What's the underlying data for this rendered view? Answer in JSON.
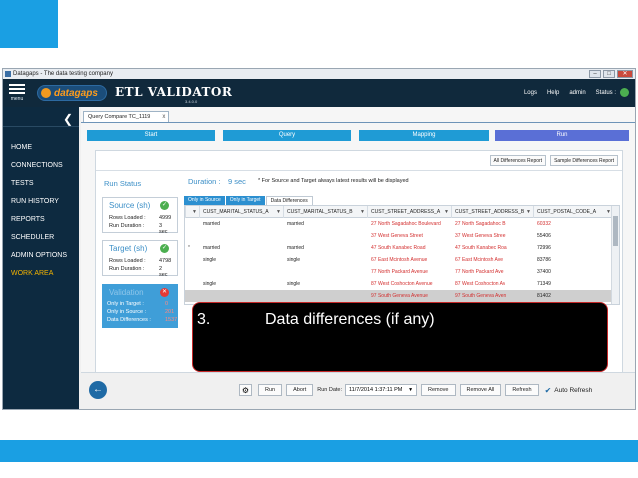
{
  "window": {
    "title": "Datagaps - The data testing company",
    "controls": [
      "–",
      "□",
      "✕"
    ]
  },
  "header": {
    "menu_label": "menu",
    "logo_text": "datagaps",
    "product_title": "ETL VALIDATOR",
    "version": "3.4.0.0",
    "links": {
      "logs": "Logs",
      "help": "Help",
      "user": "admin",
      "status_label": "Status :"
    },
    "status_color": "#4caf50"
  },
  "sidebar": {
    "back_icon": "chevron-left-icon",
    "items": [
      {
        "label": "HOME"
      },
      {
        "label": "CONNECTIONS"
      },
      {
        "label": "TESTS"
      },
      {
        "label": "RUN HISTORY"
      },
      {
        "label": "REPORTS"
      },
      {
        "label": "SCHEDULER"
      },
      {
        "label": "ADMIN OPTIONS"
      },
      {
        "label": "WORK AREA",
        "active": true
      }
    ]
  },
  "doc_tab": {
    "label": "Query Compare TC_1119",
    "close": "x"
  },
  "steps": [
    {
      "label": "Start"
    },
    {
      "label": "Query"
    },
    {
      "label": "Mapping"
    },
    {
      "label": "Run",
      "active": true
    }
  ],
  "run_panel": {
    "report_buttons": {
      "all": "All Differences Report",
      "sample": "Sample Differences Report"
    },
    "run_status": "Run Status",
    "duration_label": "Duration :",
    "duration_value": "9 sec",
    "note": "* For Source and Target always latest results will be displayed",
    "source": {
      "title": "Source (sh)",
      "rows_label": "Rows Loaded :",
      "rows": "4999",
      "duration_label": "Run Duration :",
      "duration": "3 sec"
    },
    "target": {
      "title": "Target (sh)",
      "rows_label": "Rows Loaded :",
      "rows": "4798",
      "duration_label": "Run Duration :",
      "duration": "2 sec"
    },
    "validation": {
      "title": "Validation",
      "only_target_label": "Only in Target :",
      "only_target": "0",
      "only_source_label": "Only in Source :",
      "only_source": "201",
      "differences_label": "Data Differences :",
      "differences": "1537"
    },
    "result_tabs": [
      {
        "label": "Only in Source"
      },
      {
        "label": "Only in Target"
      },
      {
        "label": "Data Differences",
        "active": true
      }
    ],
    "grid": {
      "columns": [
        "CUST_MARITAL_STATUS_A",
        "CUST_MARITAL_STATUS_B",
        "CUST_STREET_ADDRESS_A",
        "CUST_STREET_ADDRESS_B",
        "CUST_POSTAL_CODE_A"
      ],
      "rows": [
        {
          "c1": "married",
          "c2": "married",
          "c3": "27 North Sagadahoc Boulevard",
          "c4": "27 North Sagadahoc B",
          "c5": "60332",
          "red5": true
        },
        {
          "c1": "",
          "c2": "",
          "c3": "37 West Geneva Street",
          "c4": "37 West Geneva Stree",
          "c5": "55406",
          "red5": false
        },
        {
          "c1": "married",
          "c2": "married",
          "c3": "47 South Kanabec Road",
          "c4": "47 South Kanabec Roa",
          "c5": "72996",
          "red5": false
        },
        {
          "c1": "single",
          "c2": "single",
          "c3": "67 East Mcintosh Avenue",
          "c4": "67 East Mcintosh Ave",
          "c5": "83786",
          "red5": false
        },
        {
          "c1": "",
          "c2": "",
          "c3": "77 North Packard Avenue",
          "c4": "77 North Packard Ave",
          "c5": "37400",
          "red5": false
        },
        {
          "c1": "single",
          "c2": "single",
          "c3": "87 West Coshocton Avenue",
          "c4": "87 West Coshocton Av",
          "c5": "71349",
          "red5": false
        },
        {
          "c1": "",
          "c2": "",
          "c3": "97 South Geneva Avenue",
          "c4": "97 South Geneva Aven",
          "c5": "81402",
          "red5": false,
          "selected": true
        }
      ],
      "row_indicator": "*"
    }
  },
  "overlay": {
    "number": "3.",
    "text": "Data differences (if any)"
  },
  "bottom_bar": {
    "run": "Run",
    "abort": "Abort",
    "run_date_label": "Run Date:",
    "run_date": "11/7/2014 1:37:11 PM",
    "remove": "Remove",
    "remove_all": "Remove All",
    "refresh": "Refresh",
    "auto_refresh": "Auto Refresh"
  },
  "colors": {
    "accent": "#1a9fe3",
    "step": "#1f9bd5",
    "step_active": "#5a6fd6",
    "sidebar_bg": "#0d2a40",
    "diff_red": "#d32f2f"
  }
}
